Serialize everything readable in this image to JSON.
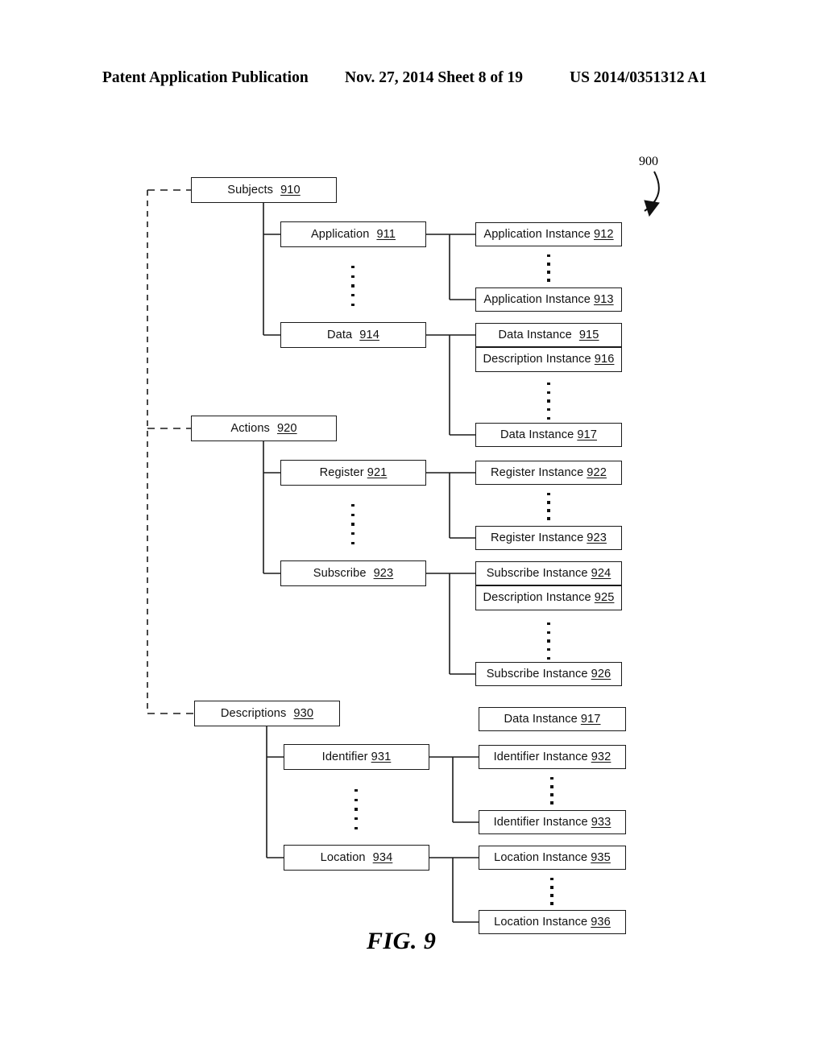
{
  "header": {
    "publication": "Patent Application Publication",
    "date_sheet": "Nov. 27, 2014  Sheet 8 of 19",
    "pub_number": "US 2014/0351312 A1"
  },
  "figure": {
    "caption": "FIG. 9",
    "diagram_ref": "900"
  },
  "nodes": {
    "subjects": {
      "label": "Subjects",
      "ref": "910"
    },
    "application": {
      "label": "Application",
      "ref": "911"
    },
    "application_inst_1": {
      "label": "Application Instance",
      "ref": "912"
    },
    "application_inst_n": {
      "label": "Application Instance",
      "ref": "913"
    },
    "data": {
      "label": "Data",
      "ref": "914"
    },
    "data_inst_1": {
      "label": "Data Instance",
      "ref": "915"
    },
    "description_inst_1": {
      "label": "Description Instance",
      "ref": "916"
    },
    "data_inst_n": {
      "label": "Data Instance",
      "ref": "917"
    },
    "actions": {
      "label": "Actions",
      "ref": "920"
    },
    "register": {
      "label": "Register",
      "ref": "921"
    },
    "register_inst_1": {
      "label": "Register Instance",
      "ref": "922"
    },
    "register_inst_n": {
      "label": "Register Instance",
      "ref": "923"
    },
    "subscribe": {
      "label": "Subscribe",
      "ref": "923"
    },
    "subscribe_inst_1": {
      "label": "Subscribe Instance",
      "ref": "924"
    },
    "description_inst_2": {
      "label": "Description Instance",
      "ref": "925"
    },
    "subscribe_inst_n": {
      "label": "Subscribe Instance",
      "ref": "926"
    },
    "descriptions": {
      "label": "Descriptions",
      "ref": "930"
    },
    "data_inst_loose": {
      "label": "Data Instance",
      "ref": "917"
    },
    "identifier": {
      "label": "Identifier",
      "ref": "931"
    },
    "identifier_inst_1": {
      "label": "Identifier Instance",
      "ref": "932"
    },
    "identifier_inst_n": {
      "label": "Identifier Instance",
      "ref": "933"
    },
    "location": {
      "label": "Location",
      "ref": "934"
    },
    "location_inst_1": {
      "label": "Location Instance",
      "ref": "935"
    },
    "location_inst_n": {
      "label": "Location Instance",
      "ref": "936"
    }
  },
  "colors": {
    "ink": "#111111",
    "page": "#ffffff"
  }
}
